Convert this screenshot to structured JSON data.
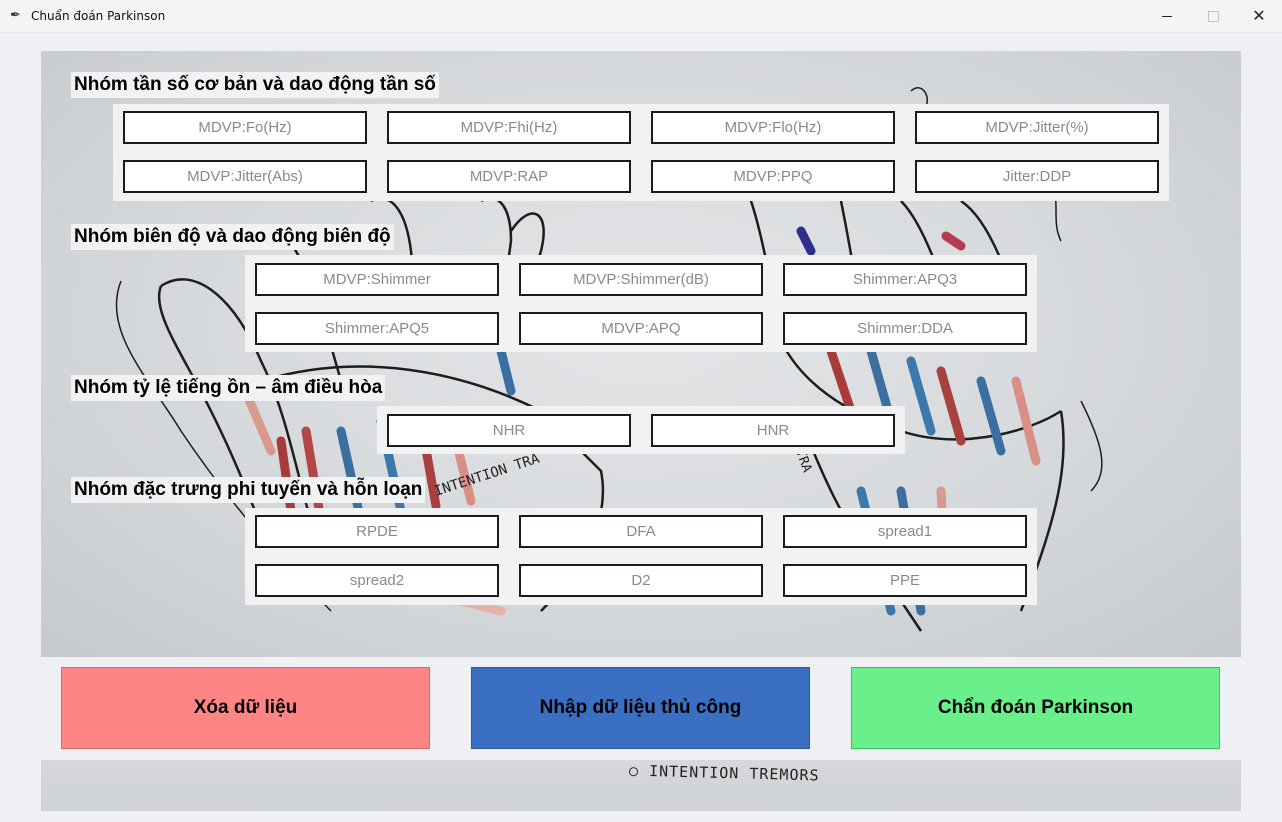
{
  "window": {
    "title": "Chuẩn đoán Parkinson",
    "app_icon": "feather-icon"
  },
  "groups": [
    {
      "title": "Nhóm tần số cơ bản và dao động tần số",
      "fields": [
        "MDVP:Fo(Hz)",
        "MDVP:Fhi(Hz)",
        "MDVP:Flo(Hz)",
        "MDVP:Jitter(%)",
        "MDVP:Jitter(Abs)",
        "MDVP:RAP",
        "MDVP:PPQ",
        "Jitter:DDP"
      ]
    },
    {
      "title": "Nhóm biên độ và dao động biên độ",
      "fields": [
        "MDVP:Shimmer",
        "MDVP:Shimmer(dB)",
        "Shimmer:APQ3",
        "Shimmer:APQ5",
        "MDVP:APQ",
        "Shimmer:DDA"
      ]
    },
    {
      "title": "Nhóm tỷ lệ tiếng ồn – âm điều hòa",
      "fields": [
        "NHR",
        "HNR"
      ]
    },
    {
      "title": "Nhóm đặc trưng phi tuyến và hỗn loạn",
      "fields": [
        "RPDE",
        "DFA",
        "spread1",
        "spread2",
        "D2",
        "PPE"
      ]
    }
  ],
  "actions": {
    "clear": "Xóa dữ liệu",
    "manual": "Nhập dữ liệu thủ công",
    "diagnose": "Chẩn đoán Parkinson"
  },
  "background": {
    "illustration": "hands-tremor-sketch",
    "sketch_text_main": "INTENTION TRA",
    "sketch_text_side": "TRA",
    "caption": "○ INTENTION TREMORS"
  },
  "colors": {
    "clear": "#ff8585",
    "manual": "#3b6fc3",
    "diagnose": "#6af08a"
  }
}
